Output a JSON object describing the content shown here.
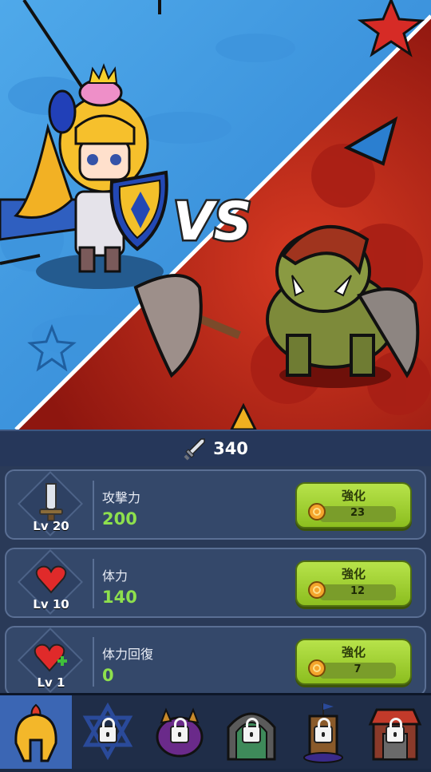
{
  "battle": {
    "vs_text": "VS",
    "hero": "princess-knight",
    "enemy": "orc-axe-warrior"
  },
  "power": {
    "icon": "sword-icon",
    "value": "340"
  },
  "stats": [
    {
      "icon": "sword-icon",
      "level": "Lv 20",
      "name": "攻撃力",
      "value": "200",
      "button_label": "強化",
      "cost": "23"
    },
    {
      "icon": "heart-icon",
      "level": "Lv 10",
      "name": "体力",
      "value": "140",
      "button_label": "強化",
      "cost": "12"
    },
    {
      "icon": "heart-plus-icon",
      "level": "Lv 1",
      "name": "体力回復",
      "value": "0",
      "button_label": "強化",
      "cost": "7"
    }
  ],
  "tabs": [
    {
      "icon": "spartan-helmet-icon",
      "locked": false,
      "active": true
    },
    {
      "icon": "hexagram-icon",
      "locked": true
    },
    {
      "icon": "purple-beast-icon",
      "locked": true
    },
    {
      "icon": "dungeon-gate-icon",
      "locked": true
    },
    {
      "icon": "tower-icon",
      "locked": true
    },
    {
      "icon": "shop-icon",
      "locked": true
    }
  ],
  "colors": {
    "stat_value": "#8ee04d",
    "upgrade_button": "#a5d63a",
    "active_tab": "#3b66b4"
  }
}
